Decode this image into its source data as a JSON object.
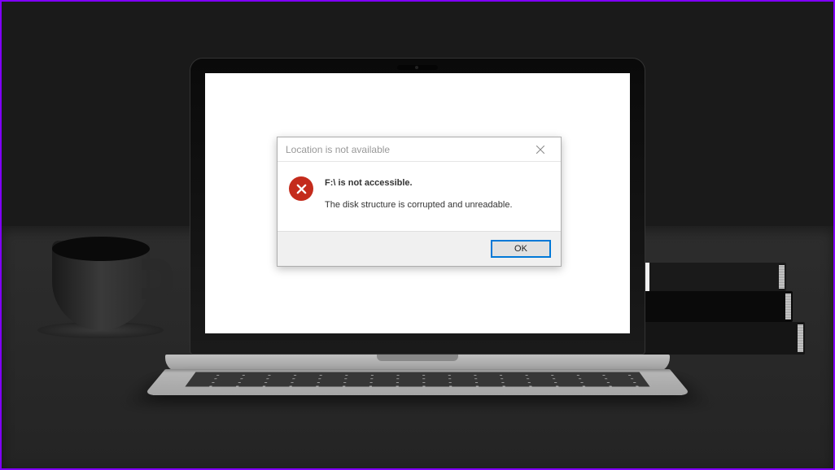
{
  "dialog": {
    "title": "Location is not available",
    "message_primary": "F:\\ is not accessible.",
    "message_secondary": "The disk structure is corrupted and unreadable.",
    "ok_label": "OK"
  }
}
